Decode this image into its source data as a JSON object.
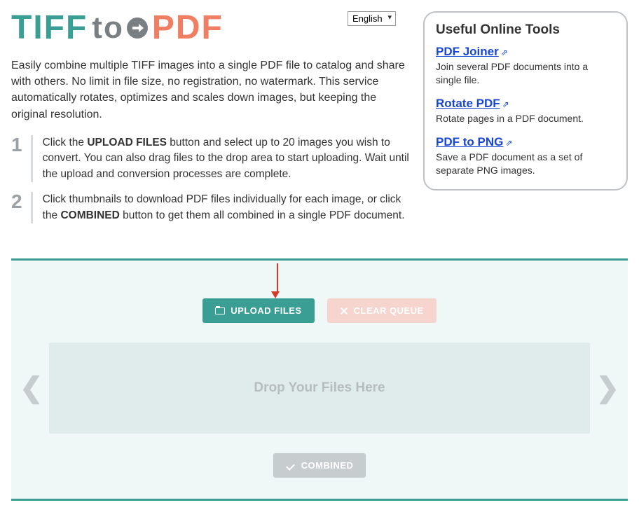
{
  "logo": {
    "tiff": "TIFF",
    "to": "to",
    "pdf": "PDF"
  },
  "language": {
    "selected": "English"
  },
  "intro": "Easily combine multiple TIFF images into a single PDF file to catalog and share with others. No limit in file size, no registration, no watermark. This service automatically rotates, optimizes and scales down images, but keeping the original resolution.",
  "steps": [
    {
      "num": "1",
      "pre": "Click the ",
      "bold1": "UPLOAD FILES",
      "mid": " button and select up to 20 images you wish to convert. You can also drag files to the drop area to start uploading. Wait until the upload and conversion processes are complete."
    },
    {
      "num": "2",
      "pre": "Click thumbnails to download PDF files individually for each image, or click the ",
      "bold1": "COMBINED",
      "mid": " button to get them all combined in a single PDF document."
    }
  ],
  "sidebar": {
    "title": "Useful Online Tools",
    "items": [
      {
        "name": "PDF Joiner",
        "desc": "Join several PDF documents into a single file."
      },
      {
        "name": "Rotate PDF",
        "desc": "Rotate pages in a PDF document."
      },
      {
        "name": "PDF to PNG",
        "desc": "Save a PDF document as a set of separate PNG images."
      }
    ]
  },
  "buttons": {
    "upload": "UPLOAD FILES",
    "clear": "CLEAR QUEUE",
    "combined": "COMBINED"
  },
  "dropzone": {
    "text": "Drop Your Files Here"
  }
}
